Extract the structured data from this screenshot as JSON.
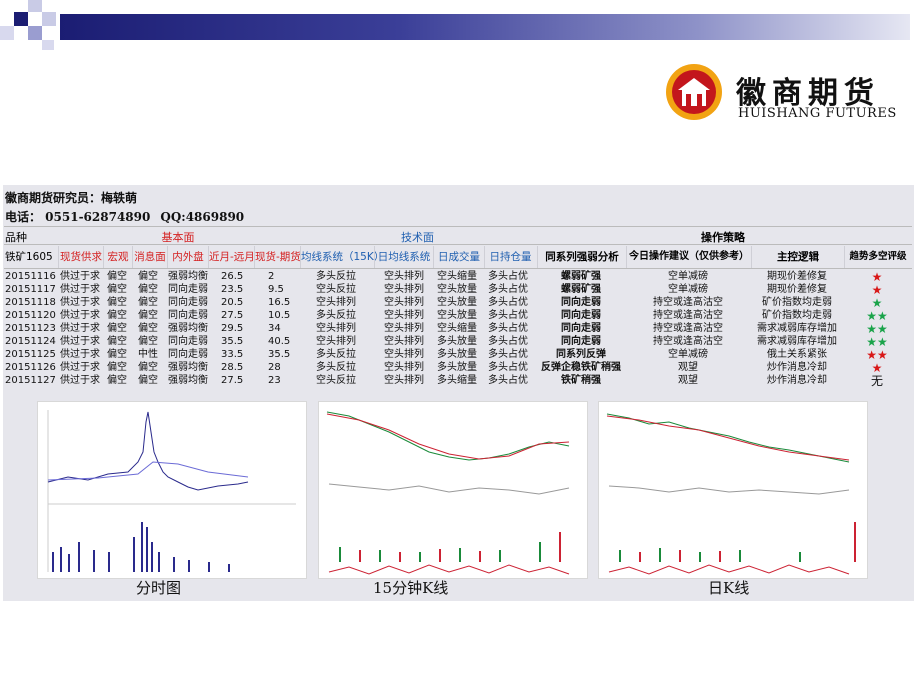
{
  "logo": {
    "cn": "徽商期货",
    "en": "HUISHANG FUTURES"
  },
  "researcher": "徽商期货研究员：梅轶萌",
  "contact": {
    "phone": "电话： 0551-62874890",
    "qq": "QQ:4869890"
  },
  "groups": {
    "basic": "基本面",
    "technical": "技术面",
    "strategy": "操作策略"
  },
  "columns": [
    "品种",
    "铁矿1605",
    "现货供求",
    "宏观",
    "消息面",
    "内外盘",
    "近月-远月",
    "现货-期货",
    "均线系统（15K）",
    "日均线系统",
    "日成交量",
    "日持仓量",
    "同系列强弱分析",
    "今日操作建议（仅供参考）",
    "主控逻辑",
    "趋势多空评级"
  ],
  "rows": [
    {
      "date": "20151116",
      "supply": "供过于求",
      "macro": "偏空",
      "news": "偏空",
      "inout": "强弱均衡",
      "spread": "26.5",
      "basis": "2",
      "ma15": "多头反拉",
      "dma": "空头排列",
      "vol": "空头缩量",
      "oi": "多头占优",
      "series": "螺弱矿强",
      "advice": "空单减磅",
      "logic": "期现价差修复",
      "rating": "★",
      "rcolor": "red"
    },
    {
      "date": "20151117",
      "supply": "供过于求",
      "macro": "偏空",
      "news": "偏空",
      "inout": "同向走弱",
      "spread": "23.5",
      "basis": "9.5",
      "ma15": "空头反拉",
      "dma": "空头排列",
      "vol": "空头放量",
      "oi": "多头占优",
      "series": "螺弱矿强",
      "advice": "空单减磅",
      "logic": "期现价差修复",
      "rating": "★",
      "rcolor": "red"
    },
    {
      "date": "20151118",
      "supply": "供过于求",
      "macro": "偏空",
      "news": "偏空",
      "inout": "同向走弱",
      "spread": "20.5",
      "basis": "16.5",
      "ma15": "空头排列",
      "dma": "空头排列",
      "vol": "空头放量",
      "oi": "多头占优",
      "series": "同向走弱",
      "advice": "持空或逢高沽空",
      "logic": "矿价指数均走弱",
      "rating": "★",
      "rcolor": "green"
    },
    {
      "date": "20151120",
      "supply": "供过于求",
      "macro": "偏空",
      "news": "偏空",
      "inout": "同向走弱",
      "spread": "27.5",
      "basis": "10.5",
      "ma15": "多头反拉",
      "dma": "空头排列",
      "vol": "空头放量",
      "oi": "多头占优",
      "series": "同向走弱",
      "advice": "持空或逢高沽空",
      "logic": "矿价指数均走弱",
      "rating": "★★",
      "rcolor": "green"
    },
    {
      "date": "20151123",
      "supply": "供过于求",
      "macro": "偏空",
      "news": "偏空",
      "inout": "强弱均衡",
      "spread": "29.5",
      "basis": "34",
      "ma15": "空头排列",
      "dma": "空头排列",
      "vol": "空头缩量",
      "oi": "多头占优",
      "series": "同向走弱",
      "advice": "持空或逢高沽空",
      "logic": "需求减弱库存增加",
      "rating": "★★",
      "rcolor": "green"
    },
    {
      "date": "20151124",
      "supply": "供过于求",
      "macro": "偏空",
      "news": "偏空",
      "inout": "同向走弱",
      "spread": "35.5",
      "basis": "40.5",
      "ma15": "空头排列",
      "dma": "空头排列",
      "vol": "多头放量",
      "oi": "多头占优",
      "series": "同向走弱",
      "advice": "持空或逢高沽空",
      "logic": "需求减弱库存增加",
      "rating": "★★",
      "rcolor": "green"
    },
    {
      "date": "20151125",
      "supply": "供过于求",
      "macro": "偏空",
      "news": "中性",
      "inout": "同向走弱",
      "spread": "33.5",
      "basis": "35.5",
      "ma15": "多头反拉",
      "dma": "空头排列",
      "vol": "多头放量",
      "oi": "多头占优",
      "series": "同系列反弹",
      "advice": "空单减磅",
      "logic": "俄土关系紧张",
      "rating": "★★",
      "rcolor": "red"
    },
    {
      "date": "20151126",
      "supply": "供过于求",
      "macro": "偏空",
      "news": "偏空",
      "inout": "强弱均衡",
      "spread": "28.5",
      "basis": "28",
      "ma15": "多头反拉",
      "dma": "空头排列",
      "vol": "多头放量",
      "oi": "多头占优",
      "series": "反弹企稳铁矿稍强",
      "advice": "观望",
      "logic": "炒作消息冷却",
      "rating": "★",
      "rcolor": "red"
    },
    {
      "date": "20151127",
      "supply": "供过于求",
      "macro": "偏空",
      "news": "偏空",
      "inout": "强弱均衡",
      "spread": "27.5",
      "basis": "23",
      "ma15": "空头反拉",
      "dma": "空头排列",
      "vol": "多头缩量",
      "oi": "多头占优",
      "series": "铁矿稍强",
      "advice": "观望",
      "logic": "炒作消息冷却",
      "rating": "无",
      "rcolor": "black"
    }
  ],
  "captions": {
    "intraday": "分时图",
    "k15": "15分钟K线",
    "daily": "日K线"
  },
  "colors": {
    "red_header": "#d42020",
    "blue_header": "#1f5fb0",
    "panel": "#e6e6ec"
  }
}
